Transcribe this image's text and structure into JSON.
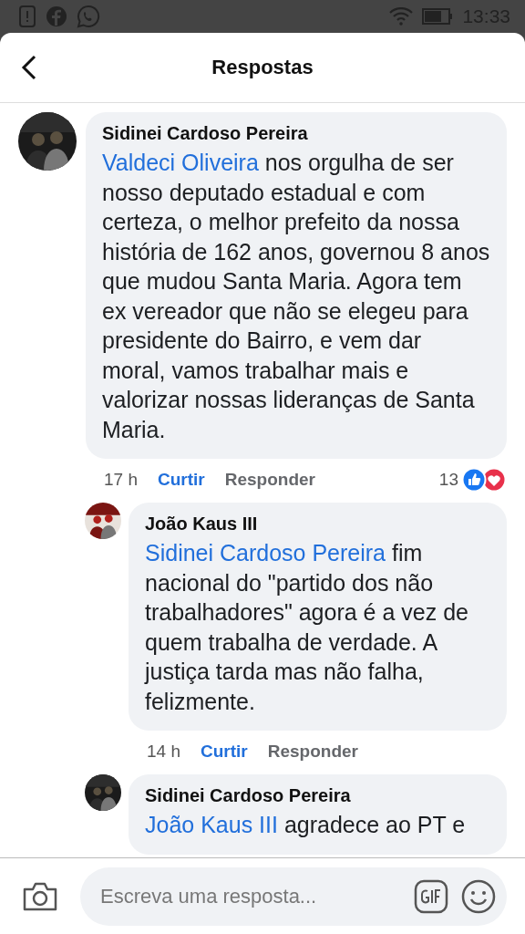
{
  "status_bar": {
    "time": "13:33"
  },
  "header": {
    "title": "Respostas"
  },
  "comments": [
    {
      "author": "Sidinei Cardoso Pereira",
      "mention": "Valdeci Oliveira",
      "text": " nos orgulha de ser nosso deputado estadual e com certeza, o melhor prefeito da nossa história de 162 anos, governou 8 anos que mudou Santa Maria. Agora tem ex vereador que não se elegeu para presidente do Bairro, e vem dar moral, vamos trabalhar mais e valorizar nossas lideranças de Santa Maria.",
      "time": "17 h",
      "like": "Curtir",
      "reply": "Responder",
      "reaction_count": "13",
      "children": [
        {
          "author": "João Kaus III",
          "mention": "Sidinei Cardoso Pereira",
          "text": " fim nacional do \"partido dos não trabalhadores\" agora é a vez de quem trabalha de verdade. A justiça tarda mas não falha, felizmente.",
          "time": "14 h",
          "like": "Curtir",
          "reply": "Responder"
        },
        {
          "author": "Sidinei Cardoso Pereira",
          "mention": "João Kaus III",
          "text": " agradece ao PT e"
        }
      ]
    }
  ],
  "composer": {
    "placeholder": "Escreva uma resposta..."
  }
}
